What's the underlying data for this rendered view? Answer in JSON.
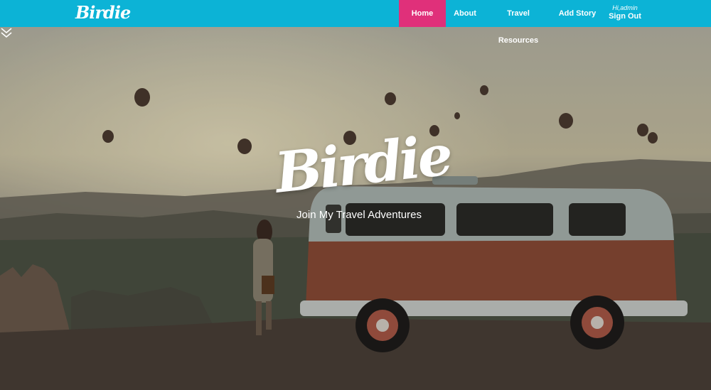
{
  "brand": {
    "logo_text": "Birdie"
  },
  "nav": {
    "items": [
      "Home",
      "About",
      "Travel Resources",
      "Add Story"
    ],
    "active": "Home",
    "greeting": "Hi,admin",
    "signout": "Sign Out"
  },
  "hero": {
    "title": "Birdie",
    "tagline": "Join My Travel Adventures",
    "scroll_icon": "chevron-double-down-icon"
  },
  "colors": {
    "nav_bg": "#0cb3d6",
    "active_tab": "#e0307a"
  }
}
